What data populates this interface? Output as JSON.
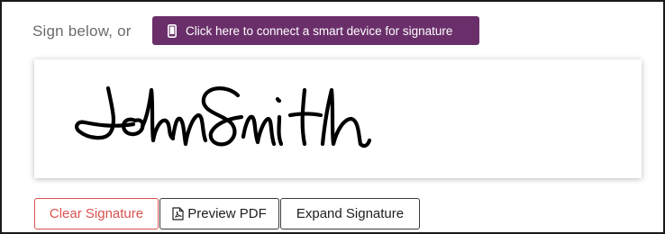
{
  "prompt": {
    "label": "Sign below, or"
  },
  "connect": {
    "label": "Click here to connect a smart device for signature",
    "icon": "mobile-phone-icon",
    "color": "#6a2f6a"
  },
  "signature": {
    "value": "John Smith"
  },
  "actions": {
    "clear_label": "Clear Signature",
    "clear_color": "#d9534f",
    "preview_label": "Preview PDF",
    "preview_icon": "pdf-file-icon",
    "expand_label": "Expand Signature"
  }
}
